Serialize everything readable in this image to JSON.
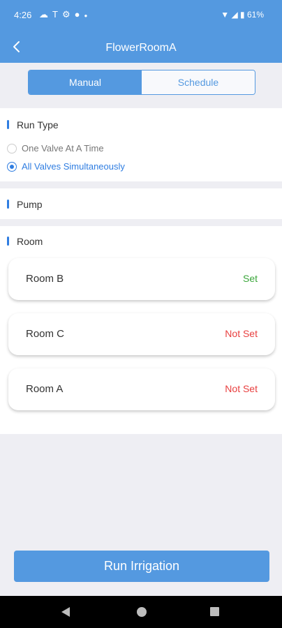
{
  "status_bar": {
    "time": "4:26",
    "left_icons": [
      "cloud-icon",
      "t-icon",
      "settings-icon",
      "circle-icon",
      "dot-icon"
    ],
    "right_icons": [
      "wifi-icon",
      "signal-icon",
      "battery-icon"
    ],
    "battery": "61%"
  },
  "nav": {
    "title": "FlowerRoomA",
    "back_icon": "chevron-left-icon"
  },
  "tabs": [
    {
      "label": "Manual",
      "active": true
    },
    {
      "label": "Schedule",
      "active": false
    }
  ],
  "run_type": {
    "title": "Run Type",
    "options": [
      {
        "label": "One Valve At A Time",
        "selected": false
      },
      {
        "label": "All Valves Simultaneously",
        "selected": true
      }
    ]
  },
  "pump": {
    "title": "Pump"
  },
  "room": {
    "title": "Room",
    "items": [
      {
        "name": "Room B",
        "status": "Set",
        "status_color": "#3aa63a"
      },
      {
        "name": "Room C",
        "status": "Not Set",
        "status_color": "#e83f3f"
      },
      {
        "name": "Room A",
        "status": "Not Set",
        "status_color": "#e83f3f"
      }
    ]
  },
  "action": {
    "run_label": "Run Irrigation"
  },
  "colors": {
    "primary": "#5499e0",
    "accent": "#2f7de1",
    "background": "#eeeef3"
  }
}
